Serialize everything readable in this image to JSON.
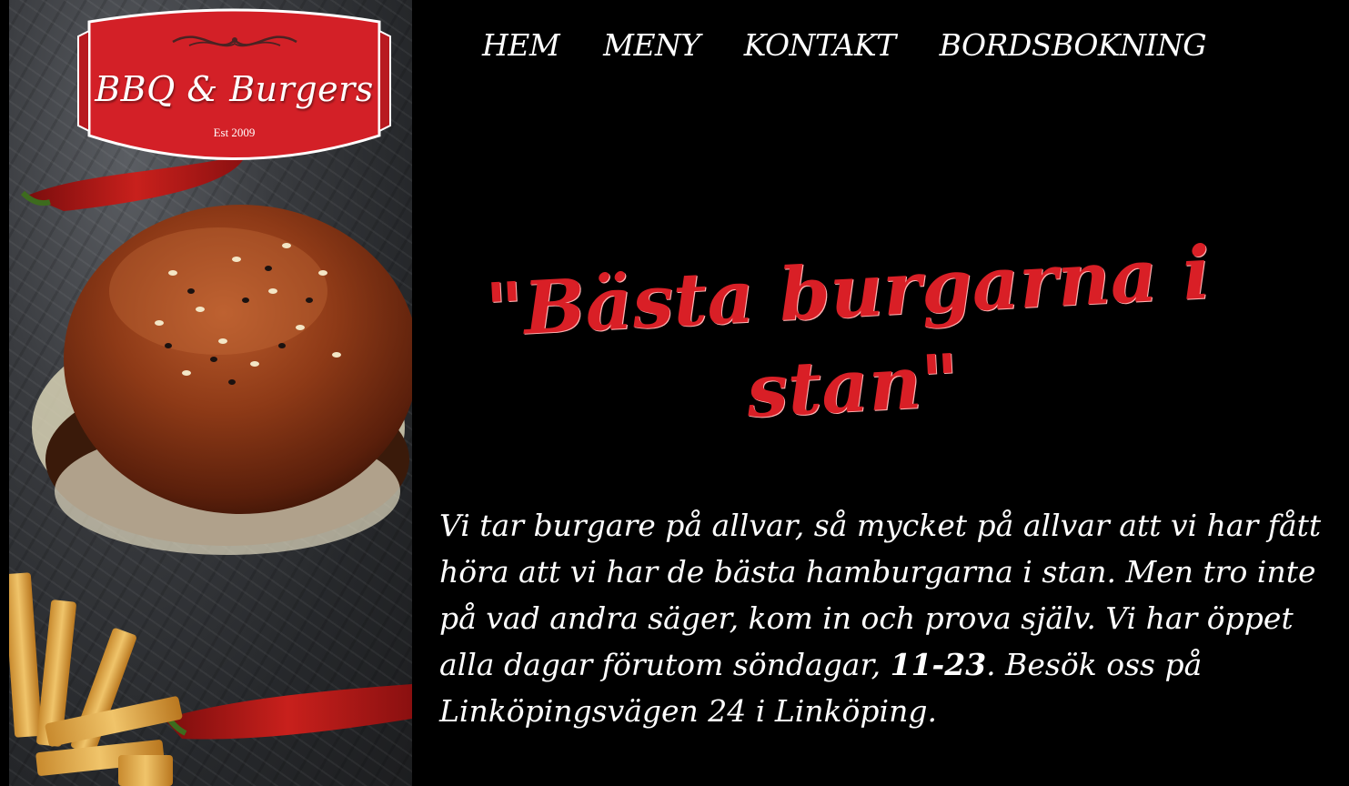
{
  "logo": {
    "title": "BBQ & Burgers",
    "established": "Est 2009",
    "badge_color": "#d32027"
  },
  "nav": {
    "items": [
      {
        "label": "HEM"
      },
      {
        "label": "MENY"
      },
      {
        "label": "KONTAKT"
      },
      {
        "label": "BORDSBOKNING"
      }
    ]
  },
  "hero": {
    "headline": "\"Bästa burgarna i stan\"",
    "headline_color": "#d91f26",
    "body_before": "Vi tar burgare på allvar, så mycket på allvar att vi har fått höra att vi har de bästa hamburgarna i stan. Men tro inte på vad andra säger, kom in och prova själv. Vi har öppet alla dagar förutom söndagar, ",
    "body_hours": "11-23",
    "body_after": ". Besök oss på Linköpingsvägen 24 i Linköping."
  },
  "image": {
    "subject": "burger-photo"
  }
}
